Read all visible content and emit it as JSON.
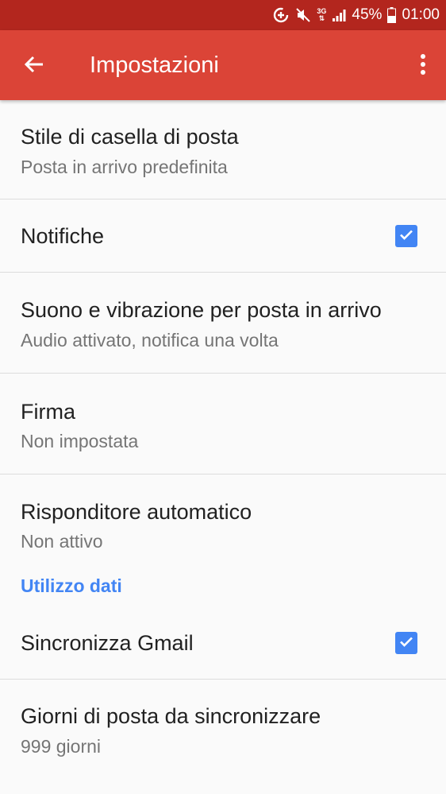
{
  "status_bar": {
    "battery_percent": "45%",
    "time": "01:00",
    "network": "3G",
    "icons": [
      "data-saver-icon",
      "mute-icon",
      "network-3g-icon",
      "signal-icon",
      "battery-icon"
    ]
  },
  "app_bar": {
    "title": "Impostazioni",
    "back_icon": "arrow-back-icon",
    "menu_icon": "more-vert-icon"
  },
  "settings": {
    "inbox_style": {
      "title": "Stile di casella di posta",
      "summary": "Posta in arrivo predefinita"
    },
    "notifications": {
      "title": "Notifiche",
      "checked": true
    },
    "sound": {
      "title": "Suono e vibrazione per posta in arrivo",
      "summary": "Audio attivato, notifica una volta"
    },
    "signature": {
      "title": "Firma",
      "summary": "Non impostata"
    },
    "auto_reply": {
      "title": "Risponditore automatico",
      "summary": "Non attivo"
    },
    "data_usage_header": "Utilizzo dati",
    "sync_gmail": {
      "title": "Sincronizza Gmail",
      "checked": true
    },
    "sync_days": {
      "title": "Giorni di posta da sincronizzare",
      "summary": "999 giorni"
    }
  },
  "colors": {
    "status_bar": "#b3261e",
    "app_bar": "#db4437",
    "accent": "#4285f4",
    "background": "#fafafa"
  }
}
